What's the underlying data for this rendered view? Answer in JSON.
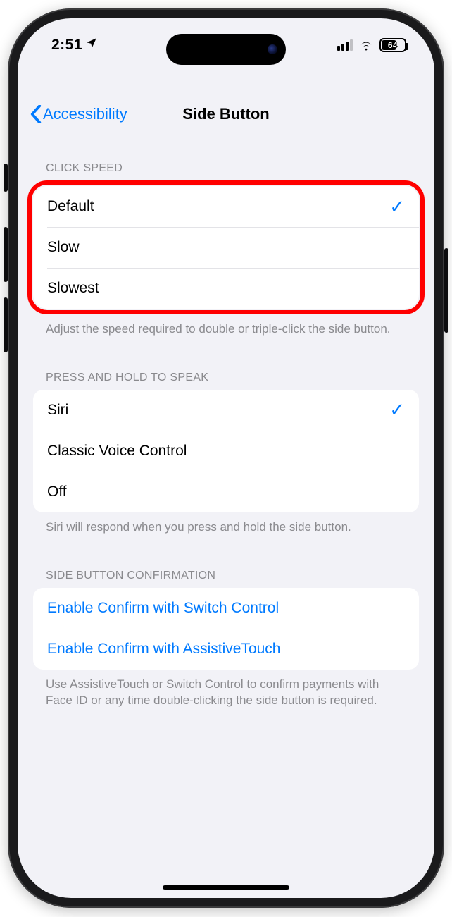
{
  "status": {
    "time": "2:51",
    "battery": "64"
  },
  "nav": {
    "back": "Accessibility",
    "title": "Side Button"
  },
  "sections": {
    "click_speed": {
      "header": "CLICK SPEED",
      "options": [
        "Default",
        "Slow",
        "Slowest"
      ],
      "selected_index": 0,
      "footer": "Adjust the speed required to double or triple-click the side button."
    },
    "press_hold": {
      "header": "PRESS AND HOLD TO SPEAK",
      "options": [
        "Siri",
        "Classic Voice Control",
        "Off"
      ],
      "selected_index": 0,
      "footer": "Siri will respond when you press and hold the side button."
    },
    "confirmation": {
      "header": "SIDE BUTTON CONFIRMATION",
      "links": [
        "Enable Confirm with Switch Control",
        "Enable Confirm with AssistiveTouch"
      ],
      "footer": "Use AssistiveTouch or Switch Control to confirm payments with Face ID or any time double-clicking the side button is required."
    }
  }
}
